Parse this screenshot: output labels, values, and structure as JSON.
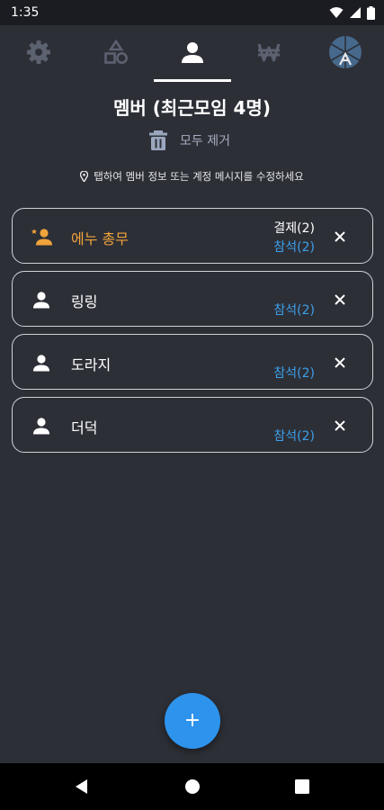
{
  "status": {
    "time": "1:35"
  },
  "tabs": [
    {
      "icon": "gear-icon",
      "active": false
    },
    {
      "icon": "shapes-icon",
      "active": false
    },
    {
      "icon": "person-icon",
      "active": true
    },
    {
      "icon": "won-icon",
      "active": false
    },
    {
      "icon": "avatar-icon",
      "active": false
    }
  ],
  "header": {
    "title": "멤버 (최근모임 4명)",
    "remove_all_label": "모두 제거",
    "hint": "탭하여 멤버 정보 또는 계정 메시지를 수정하세요"
  },
  "members": [
    {
      "name": "에누 총무",
      "leader": true,
      "pay": "결제(2)",
      "attend": "참석(2)"
    },
    {
      "name": "링링",
      "leader": false,
      "pay": "",
      "attend": "참석(2)"
    },
    {
      "name": "도라지",
      "leader": false,
      "pay": "",
      "attend": "참석(2)"
    },
    {
      "name": "더덕",
      "leader": false,
      "pay": "",
      "attend": "참석(2)"
    }
  ],
  "fab": {
    "label": "+"
  },
  "colors": {
    "background": "#2d2f37",
    "leader": "#f0a33a",
    "accent": "#3ca0ea",
    "fab": "#2d93ec"
  }
}
